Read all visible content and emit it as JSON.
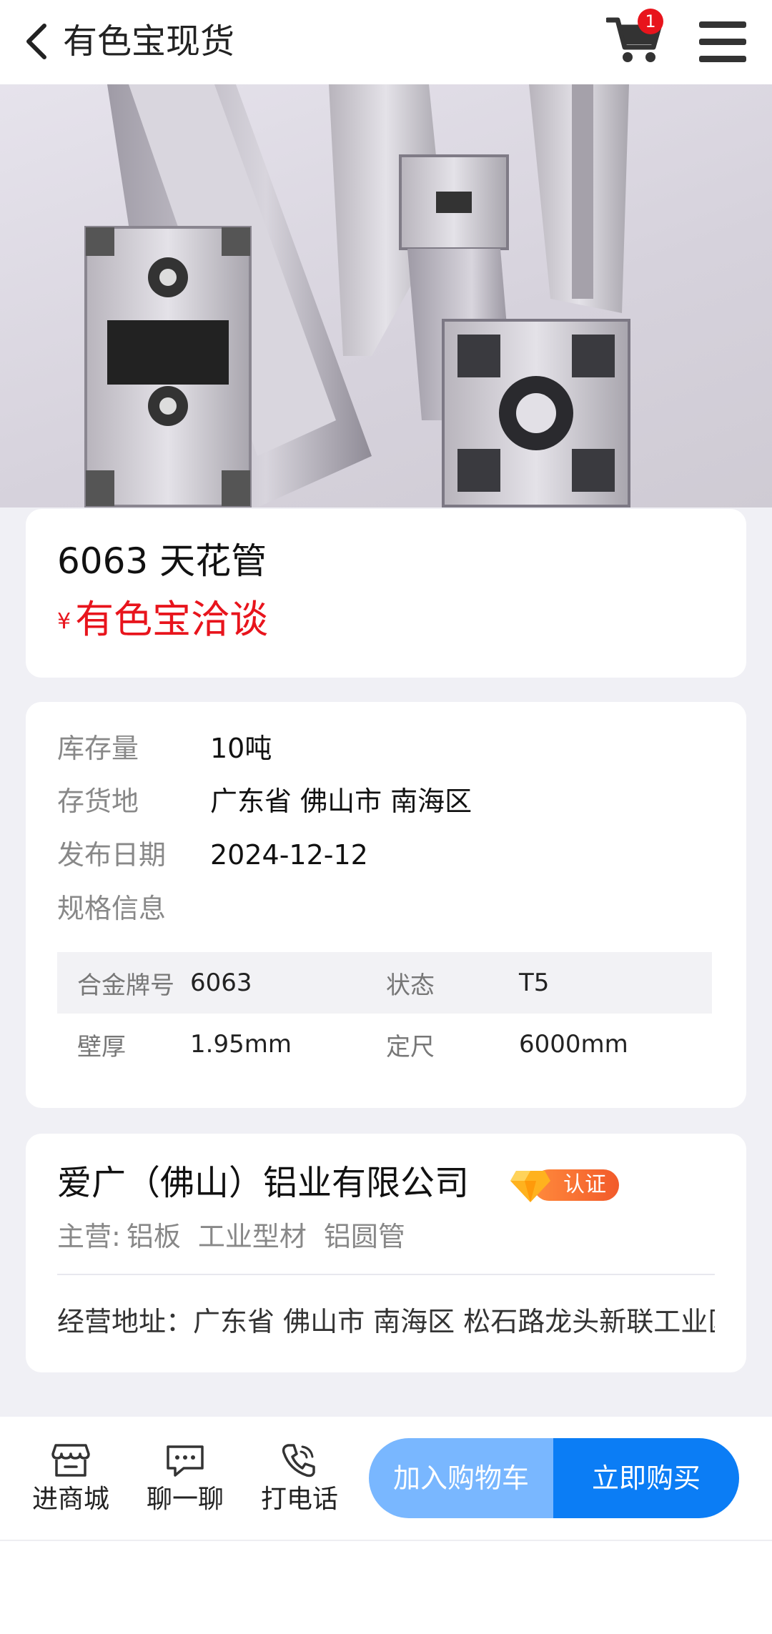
{
  "header": {
    "title": "有色宝现货",
    "cart_count": "1"
  },
  "product": {
    "name": "6063 天花管",
    "currency": "¥",
    "price": "有色宝洽谈"
  },
  "details": {
    "stock_label": "库存量",
    "stock_value": "10吨",
    "location_label": "存货地",
    "location_value": "广东省 佛山市 南海区",
    "date_label": "发布日期",
    "date_value": "2024-12-12",
    "spec_label": "规格信息",
    "specs": [
      {
        "k1": "合金牌号",
        "v1": "6063",
        "k2": "状态",
        "v2": "T5"
      },
      {
        "k1": "壁厚",
        "v1": "1.95mm",
        "k2": "定尺",
        "v2": "6000mm"
      }
    ]
  },
  "company": {
    "name": "爱广（佛山）铝业有限公司",
    "cert_label": "认证",
    "main_prefix": "主营:",
    "main_items": [
      "铝板",
      "工业型材",
      "铝圆管"
    ],
    "address": "经营地址：广东省 佛山市 南海区 松石路龙头新联工业区"
  },
  "bottom": {
    "store_label": "进商城",
    "chat_label": "聊一聊",
    "call_label": "打电话",
    "add_cart_label": "加入购物车",
    "buy_label": "立即购买"
  },
  "colors": {
    "price_red": "#e8141c",
    "primary_blue": "#0b7df5",
    "light_blue": "#79b7ff",
    "cert_orange": "#f25a2a"
  },
  "icons": [
    "back-icon",
    "cart-icon",
    "menu-icon",
    "diamond-icon",
    "store-icon",
    "chat-icon",
    "phone-icon"
  ]
}
